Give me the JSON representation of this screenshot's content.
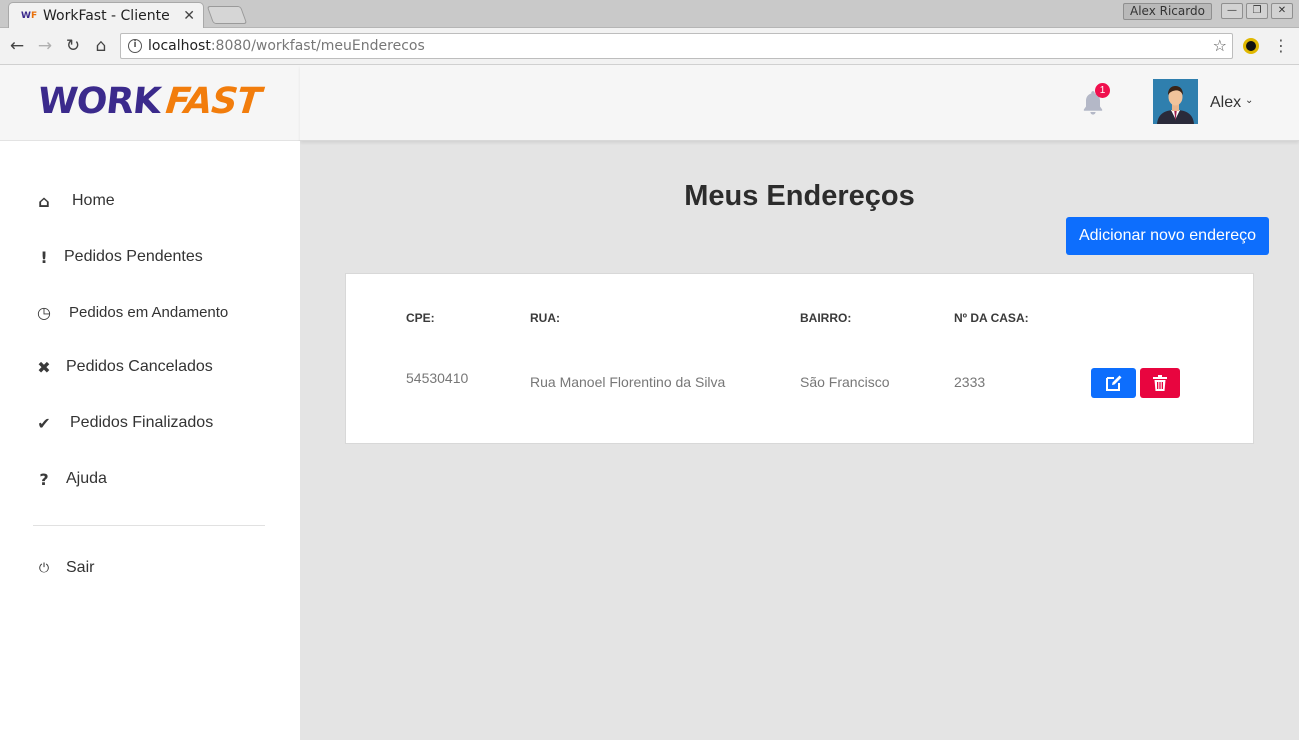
{
  "browser": {
    "tab_title": "WorkFast - Cliente",
    "tab_close": "✕",
    "favicon": {
      "w": "W",
      "f": "F"
    },
    "profile_name": "Alex Ricardo",
    "window_buttons": [
      "—",
      "❐",
      "✕"
    ],
    "nav": {
      "back": "←",
      "forward": "→",
      "reload": "↻",
      "home": "⌂"
    },
    "url_host": "localhost",
    "url_rest": ":8080/workfast/meuEnderecos",
    "star": "☆",
    "menu": "⋮",
    "info": "i"
  },
  "logo": {
    "work": "WORK",
    "fast": "FAST"
  },
  "header": {
    "notification_count": "1",
    "user_name": "Alex",
    "caret": "⌄"
  },
  "sidebar": {
    "items": [
      {
        "label": "Home",
        "icon": "home-icon",
        "glyph": "⌂"
      },
      {
        "label": "Pedidos Pendentes",
        "icon": "exclamation-icon",
        "glyph": "!"
      },
      {
        "label": "Pedidos em Andamento",
        "icon": "clock-icon",
        "glyph": "◷"
      },
      {
        "label": "Pedidos Cancelados",
        "icon": "times-icon",
        "glyph": "✖"
      },
      {
        "label": "Pedidos Finalizados",
        "icon": "check-icon",
        "glyph": "✔"
      },
      {
        "label": "Ajuda",
        "icon": "question-icon",
        "glyph": "?"
      }
    ],
    "logout": {
      "label": "Sair",
      "icon": "power-icon",
      "glyph": "⏻"
    }
  },
  "main": {
    "title": "Meus Endereços",
    "add_button": "Adicionar novo endereço",
    "table": {
      "columns": [
        "CPE:",
        "RUA:",
        "BAIRRO:",
        "Nº DA CASA:"
      ],
      "rows": [
        {
          "cep": "54530410",
          "rua": "Rua Manoel Florentino da Silva",
          "bairro": "São Francisco",
          "numero": "2333"
        }
      ]
    }
  },
  "colors": {
    "primary": "#0d6efd",
    "danger": "#e8053f",
    "logo_purple": "#3b2a8c",
    "logo_orange": "#f27d0c",
    "badge": "#f0104e"
  }
}
